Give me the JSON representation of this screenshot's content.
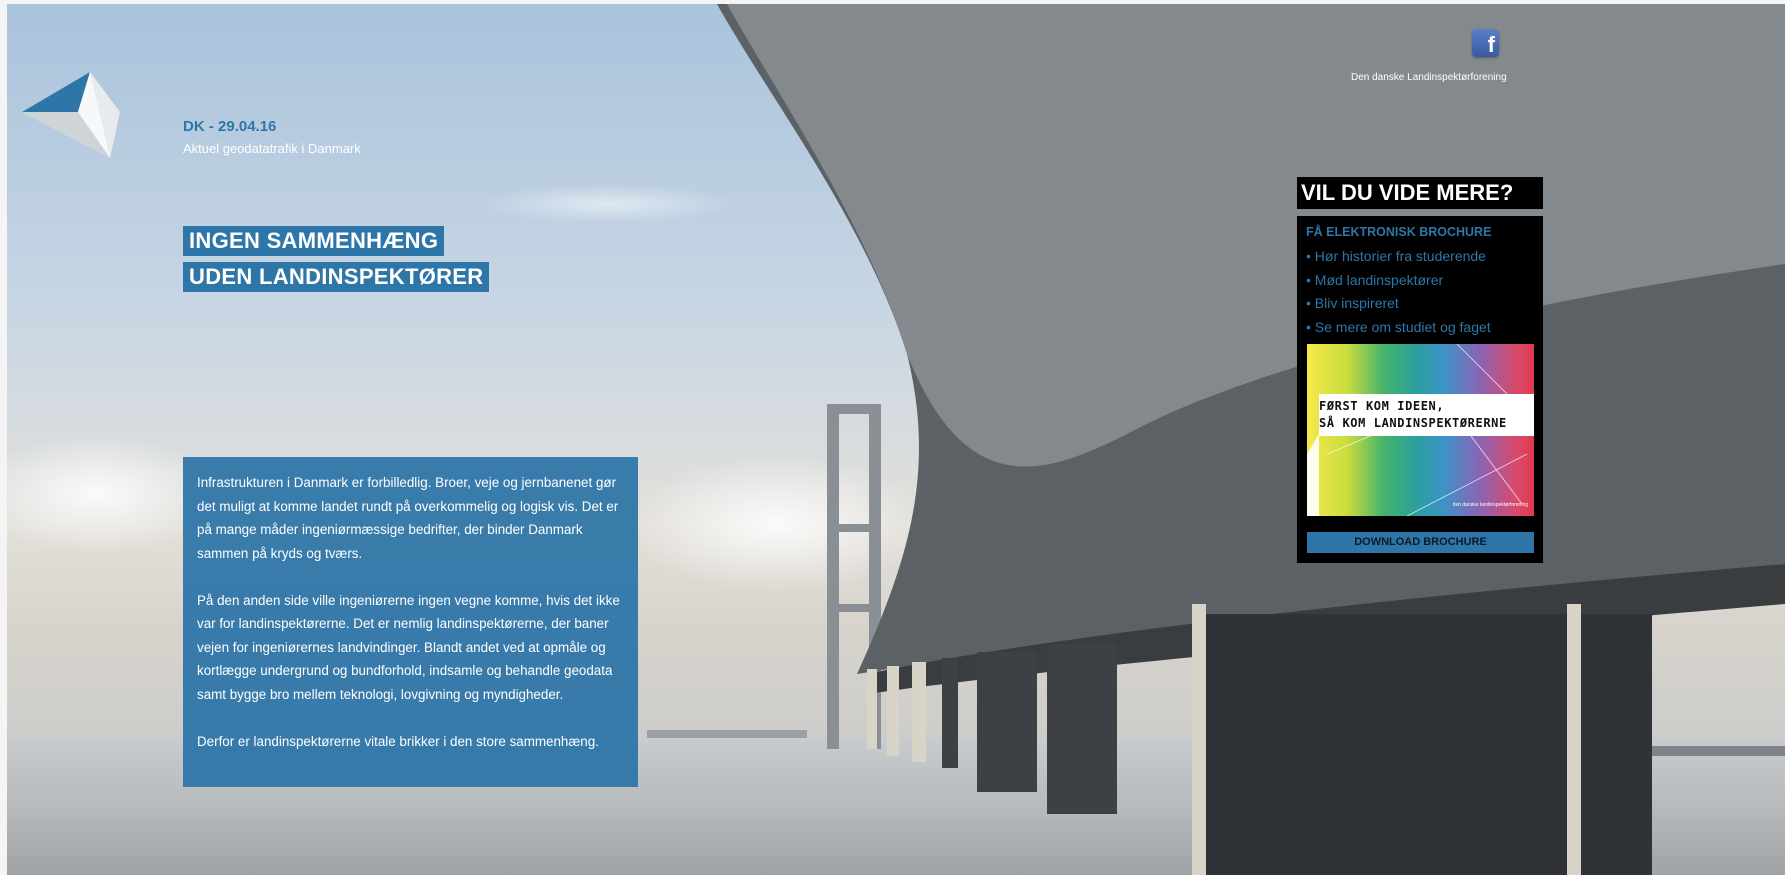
{
  "header": {
    "date": "DK - 29.04.16",
    "tagline": "Aktuel geodatatrafik i Danmark"
  },
  "headline": {
    "line1": "INGEN SAMMENHÆNG",
    "line2": "UDEN LANDINSPEKTØRER"
  },
  "article": {
    "paragraphs": [
      "Infrastrukturen i Danmark er forbilledlig. Broer, veje og jernbanenet gør det muligt at komme landet rundt på overkommelig og logisk vis. Det er på mange måder ingeniørmæssige bedrifter, der binder Danmark sammen på kryds og tværs.",
      "På den anden side ville ingeniørerne ingen vegne komme, hvis det ikke var for landinspektørerne. Det er nemlig landinspektørerne, der baner vejen for ingeniørernes landvindinger. Blandt andet ved at opmåle og kortlægge undergrund og bundforhold, indsamle og behandle geodata samt bygge bro mellem teknologi, lovgivning og myndigheder.",
      "Derfor er landinspektørerne vitale brikker i den store sammenhæng."
    ]
  },
  "social": {
    "icon": "facebook-icon",
    "glyph": "f",
    "label": "Den danske Landinspektørforening"
  },
  "sidebar": {
    "title": "VIL DU VIDE MERE?",
    "subtitle": "FÅ ELEKTRONISK BROCHURE",
    "items": [
      "• Hør historier fra studerende",
      "• Mød landinspektører",
      "• Bliv inspireret",
      "• Se mere om studiet og faget"
    ],
    "brochure": {
      "line1": "FØRST KOM IDEEN,",
      "line2": "SÅ KOM LANDINSPEKTØRERNE",
      "footer": "den danske landinspektørforening"
    },
    "download_label": "DOWNLOAD BROCHURE"
  },
  "colors": {
    "accent": "#2f76a8",
    "panel_black": "#000000"
  }
}
